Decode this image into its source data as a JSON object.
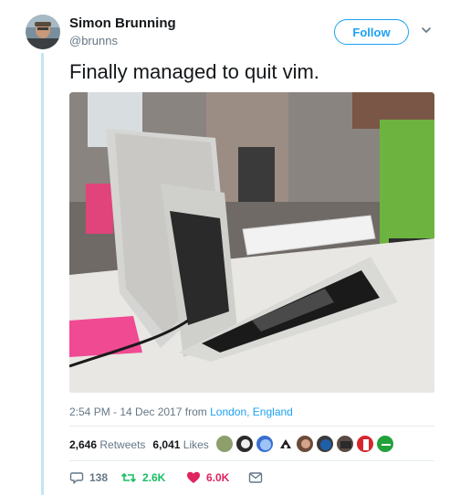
{
  "author": {
    "display_name": "Simon Brunning",
    "handle": "@brunns"
  },
  "follow": {
    "label": "Follow"
  },
  "tweet": {
    "text": "Finally managed to quit vim.",
    "time": "2:54 PM - 14 Dec 2017",
    "from_prefix": "from",
    "location": "London, England"
  },
  "stats": {
    "retweets_count": "2,646",
    "retweets_label": "Retweets",
    "likes_count": "6,041",
    "likes_label": "Likes"
  },
  "actions": {
    "replies": "138",
    "retweets": "2.6K",
    "likes": "6.0K"
  },
  "colors": {
    "accent": "#1da1f2",
    "retweet": "#17bf63",
    "like": "#e0245e",
    "thread_line": "#c4e6f5"
  }
}
